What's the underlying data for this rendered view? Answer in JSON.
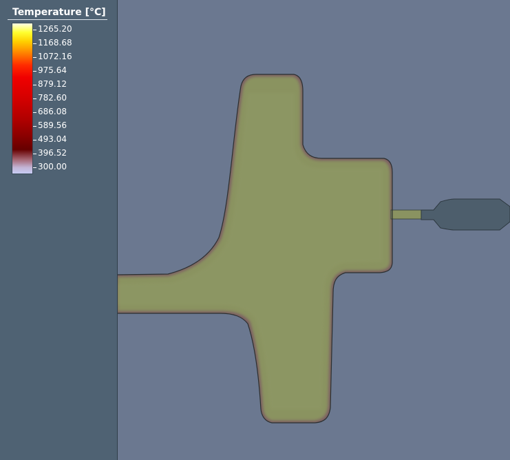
{
  "legend": {
    "title": "Temperature [°C]",
    "ticks": [
      "1265.20",
      "1168.68",
      "1072.16",
      "975.64",
      "879.12",
      "782.60",
      "686.08",
      "589.56",
      "493.04",
      "396.52",
      "300.00"
    ]
  },
  "colors": {
    "part_fill": "#8c9663",
    "background": "#6b7890",
    "panel": "#4f6273",
    "cool_edge": "#7a5660",
    "nozzle": "#4a5b69"
  }
}
